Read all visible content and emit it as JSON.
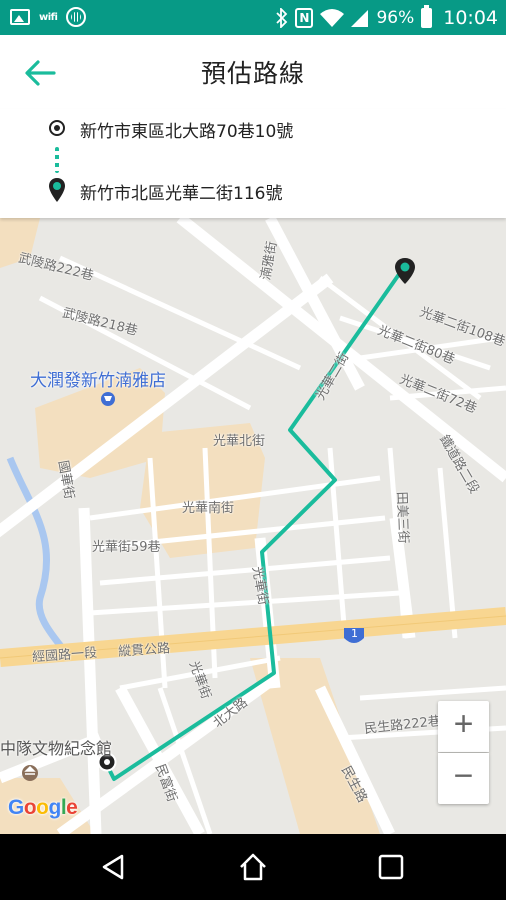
{
  "status_bar": {
    "time": "10:04",
    "battery": "96%",
    "wifi_label": "wifi",
    "icons": [
      "image-icon",
      "wifi-icon",
      "barcode-icon",
      "bluetooth-icon",
      "nfc-icon",
      "wifi-signal-icon",
      "cell-signal-icon",
      "battery-icon"
    ]
  },
  "header": {
    "title": "預估路線",
    "back_icon": "arrow-left-icon"
  },
  "route": {
    "origin": "新竹市東區北大路70巷10號",
    "destination": "新竹市北區光華二街116號"
  },
  "map": {
    "poi": {
      "mall": "大潤發新竹湳雅店",
      "museum": "中隊文物紀念館"
    },
    "streets": {
      "wuling222": "武陵路222巷",
      "wuling218": "武陵路218巷",
      "nanya": "湳雅街",
      "guanghua2_108": "光華二街108巷",
      "guanghua2_80": "光華二街80巷",
      "guanghua2": "光華二街",
      "guanghua2_72": "光華二街72巷",
      "guanghuabei": "光華北街",
      "guanghuanan": "光華南街",
      "guanghua59": "光華街59巷",
      "guanghua": "光華街",
      "guanghua_v": "光華街",
      "tianmei": "田美三街",
      "tielu": "鐵道路二段",
      "jingguo": "經國路一段",
      "zongguan": "縱貫公路",
      "beida": "北大路",
      "minsheng222": "民生路222巷",
      "minsheng": "民生路",
      "minfu": "民富街",
      "guoxiu": "國華街",
      "route_no": "1"
    },
    "zoom_in": "+",
    "zoom_out": "−",
    "google": [
      "G",
      "o",
      "o",
      "g",
      "l",
      "e"
    ],
    "route_color": "#1abc9c"
  },
  "nav": {
    "icons": [
      "back-triangle-icon",
      "home-icon",
      "recents-icon"
    ]
  }
}
